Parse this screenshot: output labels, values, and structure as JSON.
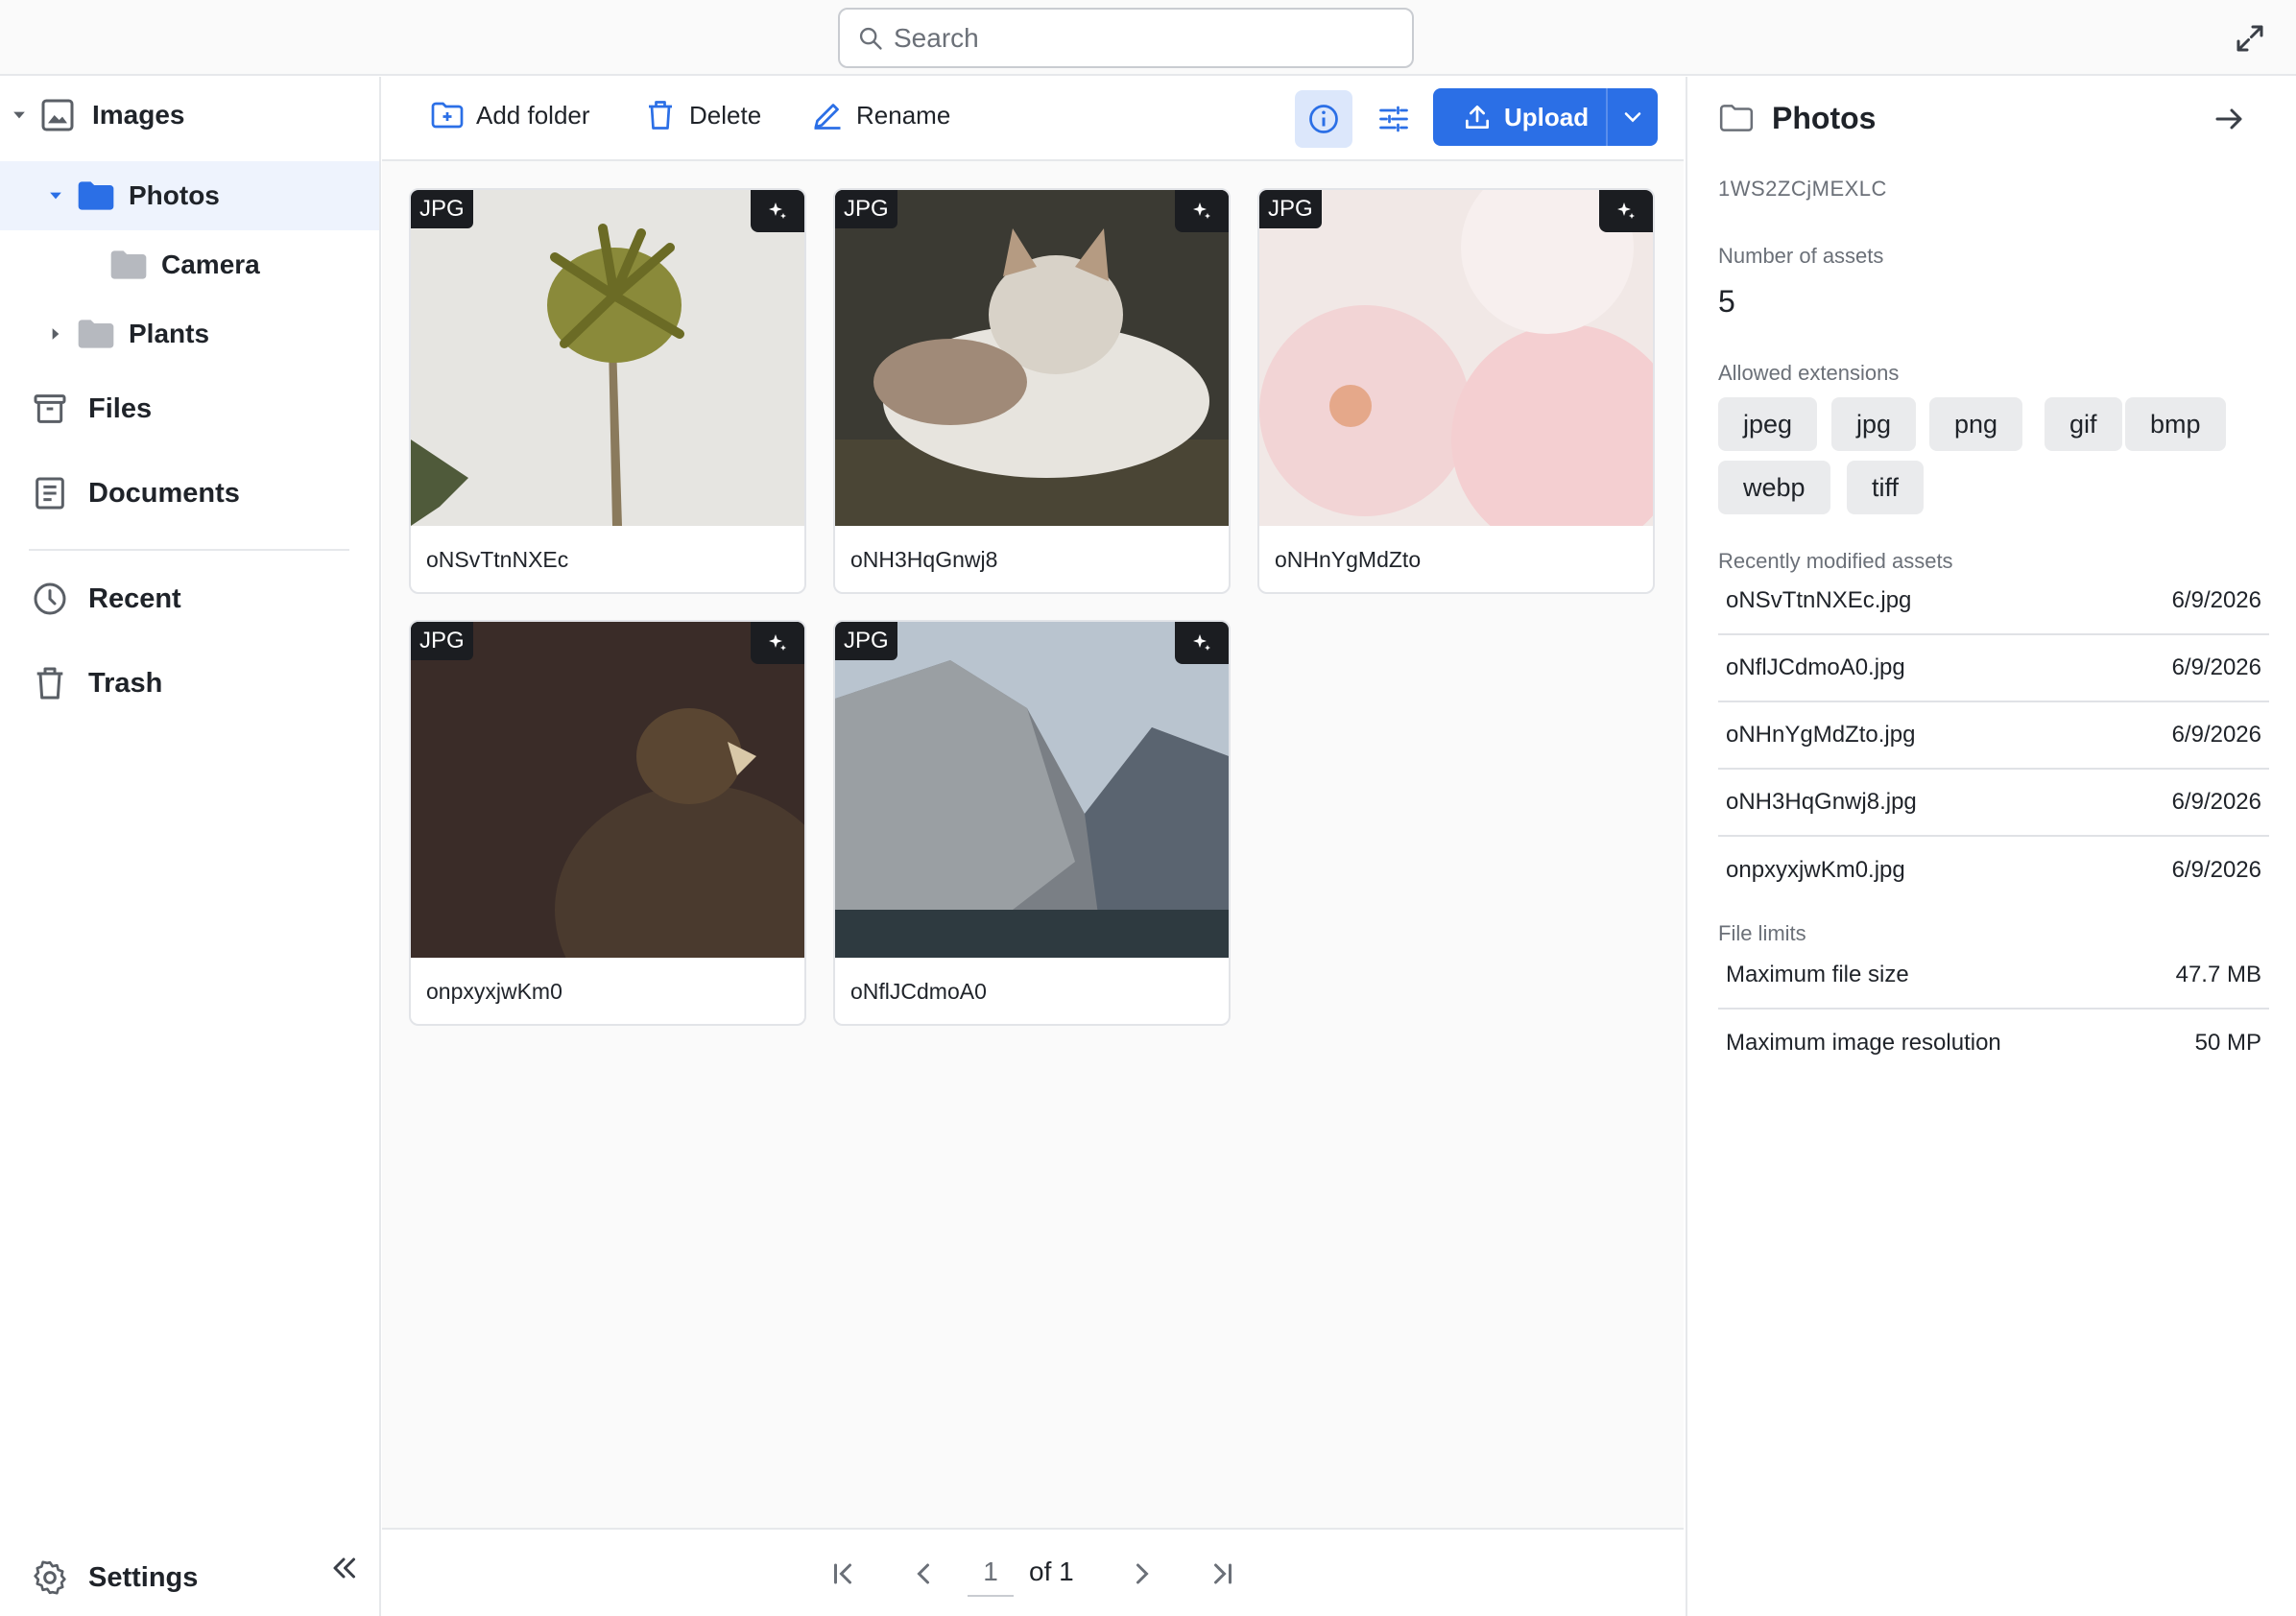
{
  "search": {
    "placeholder": "Search"
  },
  "sidebar": {
    "tree": [
      {
        "label": "Images"
      },
      {
        "label": "Photos"
      },
      {
        "label": "Camera"
      },
      {
        "label": "Plants"
      }
    ],
    "nav": [
      {
        "label": "Files"
      },
      {
        "label": "Documents"
      },
      {
        "label": "Recent"
      },
      {
        "label": "Trash"
      }
    ],
    "settings_label": "Settings"
  },
  "toolbar": {
    "add_folder_label": "Add folder",
    "delete_label": "Delete",
    "rename_label": "Rename",
    "upload_label": "Upload"
  },
  "assets": [
    {
      "name": "oNSvTtnNXEc",
      "type": "JPG"
    },
    {
      "name": "oNH3HqGnwj8",
      "type": "JPG"
    },
    {
      "name": "oNHnYgMdZto",
      "type": "JPG"
    },
    {
      "name": "onpxyxjwKm0",
      "type": "JPG"
    },
    {
      "name": "oNflJCdmoA0",
      "type": "JPG"
    }
  ],
  "pager": {
    "current": "1",
    "of_label": "of 1"
  },
  "panel": {
    "title": "Photos",
    "id": "1WS2ZCjMEXLC",
    "num_assets_label": "Number of assets",
    "num_assets": "5",
    "allowed_ext_label": "Allowed extensions",
    "extensions": [
      "jpeg",
      "jpg",
      "png",
      "gif",
      "bmp",
      "webp",
      "tiff"
    ],
    "recent_label": "Recently modified assets",
    "recent": [
      {
        "name": "oNSvTtnNXEc.jpg",
        "date": "6/9/2026"
      },
      {
        "name": "oNflJCdmoA0.jpg",
        "date": "6/9/2026"
      },
      {
        "name": "oNHnYgMdZto.jpg",
        "date": "6/9/2026"
      },
      {
        "name": "oNH3HqGnwj8.jpg",
        "date": "6/9/2026"
      },
      {
        "name": "onpxyxjwKm0.jpg",
        "date": "6/9/2026"
      }
    ],
    "limits_label": "File limits",
    "limits": [
      {
        "name": "Maximum file size",
        "value": "47.7 MB"
      },
      {
        "name": "Maximum image resolution",
        "value": "50 MP"
      }
    ]
  },
  "colors": {
    "accent": "#2b6fe6",
    "folder_selected": "#2b6fe6",
    "folder": "#b6b9bf",
    "selected_bg": "#eef3fd"
  }
}
